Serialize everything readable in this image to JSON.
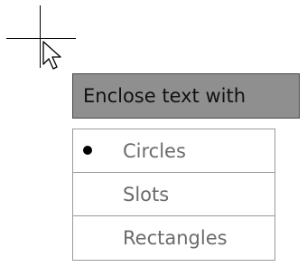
{
  "menu": {
    "header_label": "Enclose text with",
    "items": [
      {
        "label": "Circles",
        "selected": true
      },
      {
        "label": "Slots",
        "selected": false
      },
      {
        "label": "Rectangles",
        "selected": false
      }
    ]
  },
  "icons": {
    "cursor": "arrow-pointer-icon",
    "crosshair": "crosshair-icon",
    "selected_marker": "bullet-icon"
  },
  "colors": {
    "header_background": "#8f8f8f",
    "item_text": "#6b6b6b",
    "border": "#9a9a9a"
  }
}
